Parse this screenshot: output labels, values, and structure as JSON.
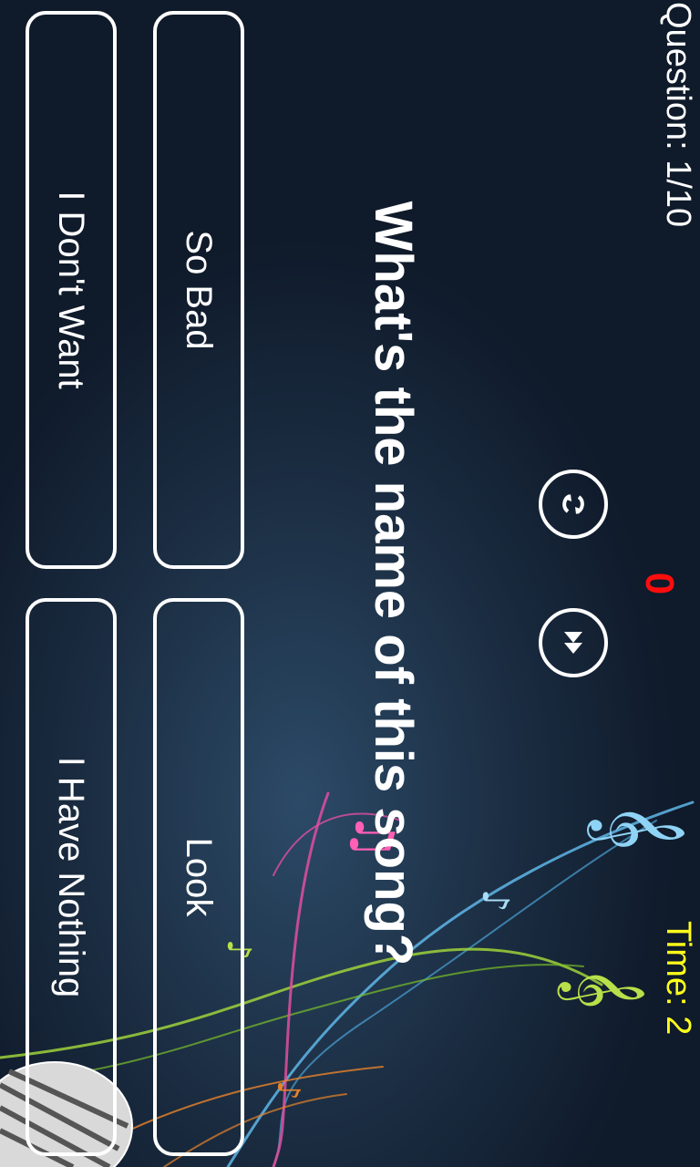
{
  "header": {
    "question_counter": "Question: 1/10",
    "timer": "Time: 2",
    "score": "0"
  },
  "controls": {
    "replay_icon": "replay-icon",
    "skip_icon": "fast-forward-icon"
  },
  "question": "What's the name of this song?",
  "answers": [
    "So Bad",
    "Look",
    "I Don't Want",
    "I Have Nothing"
  ],
  "colors": {
    "background": "#0f1a2a",
    "timer": "#ffff1a",
    "score": "#ff0d0d",
    "text": "#ffffff"
  }
}
